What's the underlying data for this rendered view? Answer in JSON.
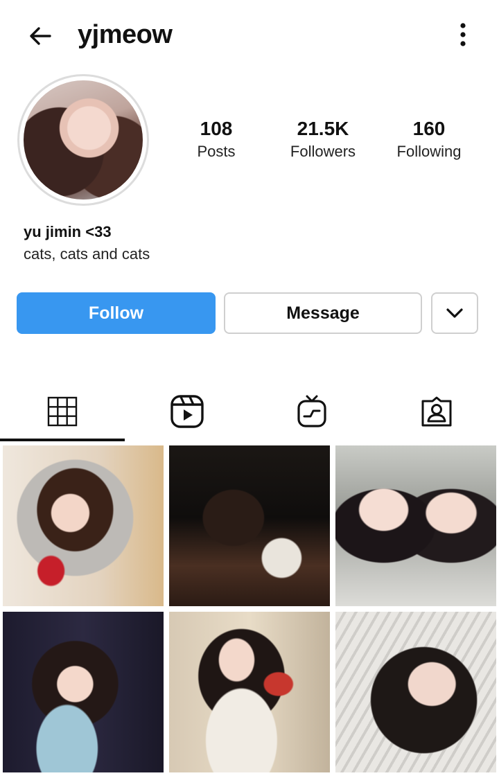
{
  "header": {
    "username": "yjmeow",
    "back_icon": "arrow-left-icon",
    "more_icon": "vertical-dots-icon"
  },
  "profile": {
    "stats": {
      "posts": {
        "value": "108",
        "label": "Posts"
      },
      "followers": {
        "value": "21.5K",
        "label": "Followers"
      },
      "following": {
        "value": "160",
        "label": "Following"
      }
    },
    "bio_name": "yu jimin <33",
    "bio_text": "cats, cats and cats"
  },
  "actions": {
    "follow_label": "Follow",
    "message_label": "Message",
    "dropdown_icon": "chevron-down-icon"
  },
  "colors": {
    "follow_button": "#3897f0",
    "text": "#111111",
    "border": "#cfcfcf"
  },
  "tabs": [
    {
      "name": "grid",
      "icon": "grid-icon",
      "selected": true
    },
    {
      "name": "reels",
      "icon": "reels-icon",
      "selected": false
    },
    {
      "name": "igtv",
      "icon": "igtv-icon",
      "selected": false
    },
    {
      "name": "tagged",
      "icon": "tagged-icon",
      "selected": false
    }
  ],
  "posts_grid": {
    "visible_count": 6
  }
}
